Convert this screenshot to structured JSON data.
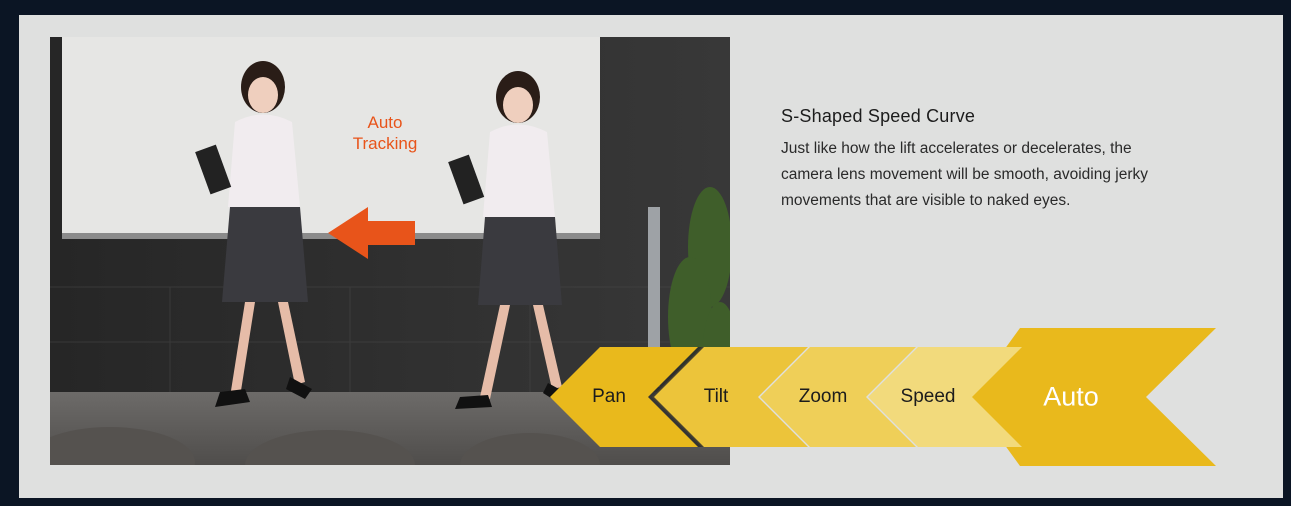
{
  "hero_image": {
    "overlay_label": "Auto\nTracking",
    "accent_color": "#e8541a"
  },
  "feature": {
    "title": "S-Shaped Speed Curve",
    "description": "Just like how the lift accelerates or decelerates, the camera lens movement will be smooth, avoiding jerky movements that are visible to naked eyes."
  },
  "chevron_steps": [
    {
      "label": "Pan",
      "color": "#e9b91c"
    },
    {
      "label": "Tilt",
      "color": "#ecc43a"
    },
    {
      "label": "Zoom",
      "color": "#efcf58"
    },
    {
      "label": "Speed",
      "color": "#f2da7c"
    },
    {
      "label": "Auto",
      "color": "#e9b91c"
    }
  ]
}
